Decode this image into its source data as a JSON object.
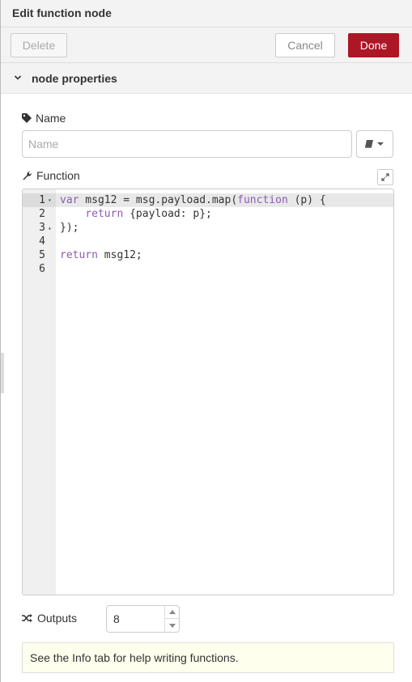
{
  "header": {
    "title": "Edit function node"
  },
  "toolbar": {
    "delete_label": "Delete",
    "cancel_label": "Cancel",
    "done_label": "Done"
  },
  "section": {
    "title": "node properties"
  },
  "name_field": {
    "label": "Name",
    "placeholder": "Name",
    "value": ""
  },
  "function_field": {
    "label": "Function"
  },
  "editor": {
    "lines": [
      {
        "num": "1",
        "fold": "▾",
        "tokens": [
          [
            "kw",
            "var"
          ],
          [
            "",
            " msg12 = msg.payload.map("
          ],
          [
            "kw",
            "function"
          ],
          [
            "",
            " (p) {"
          ]
        ]
      },
      {
        "num": "2",
        "fold": "",
        "tokens": [
          [
            "",
            "    "
          ],
          [
            "kw",
            "return"
          ],
          [
            "",
            " {payload: p};"
          ]
        ]
      },
      {
        "num": "3",
        "fold": "▴",
        "tokens": [
          [
            "",
            "});"
          ]
        ]
      },
      {
        "num": "4",
        "fold": "",
        "tokens": []
      },
      {
        "num": "5",
        "fold": "",
        "tokens": [
          [
            "kw",
            "return"
          ],
          [
            "",
            " msg12;"
          ]
        ]
      },
      {
        "num": "6",
        "fold": "",
        "tokens": []
      }
    ],
    "active_line": 1
  },
  "outputs_field": {
    "label": "Outputs",
    "value": "8"
  },
  "tip": {
    "text": "See the Info tab for help writing functions."
  },
  "colors": {
    "done": "#ad1625",
    "keyword": "#8a5bb4",
    "tip_bg": "#ffffee"
  },
  "icons": {
    "section_toggle": "chevron-down-icon",
    "name": "tag-icon",
    "library": "book-icon",
    "function": "wrench-icon",
    "expand": "expand-icon",
    "outputs": "shuffle-icon"
  }
}
